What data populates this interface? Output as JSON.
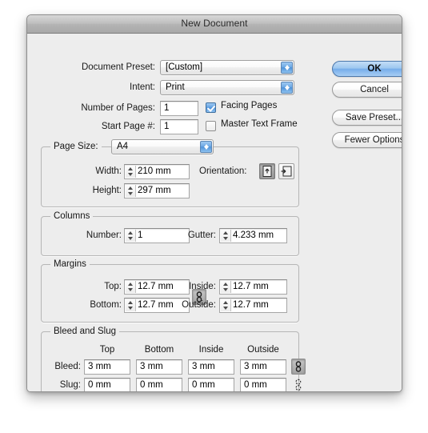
{
  "window": {
    "title": "New Document"
  },
  "fields": {
    "document_preset": {
      "label": "Document Preset:",
      "value": "[Custom]"
    },
    "intent": {
      "label": "Intent:",
      "value": "Print"
    },
    "number_of_pages": {
      "label": "Number of Pages:",
      "value": "1"
    },
    "start_page": {
      "label": "Start Page #:",
      "value": "1"
    }
  },
  "checkboxes": [
    {
      "label": "Facing Pages",
      "checked": true
    },
    {
      "label": "Master Text Frame",
      "checked": false
    }
  ],
  "buttons": {
    "ok": "OK",
    "cancel": "Cancel",
    "save_preset": "Save Preset...",
    "fewer_options": "Fewer Options"
  },
  "page_size": {
    "title": "Page Size:",
    "preset": "A4",
    "width": {
      "label": "Width:",
      "value": "210 mm"
    },
    "height": {
      "label": "Height:",
      "value": "297 mm"
    },
    "orientation": {
      "label": "Orientation:",
      "portrait_icon": "portrait-page-icon",
      "landscape_icon": "landscape-page-icon",
      "selected": "portrait"
    }
  },
  "columns": {
    "title": "Columns",
    "number": {
      "label": "Number:",
      "value": "1"
    },
    "gutter": {
      "label": "Gutter:",
      "value": "4.233 mm"
    }
  },
  "margins": {
    "title": "Margins",
    "top": {
      "label": "Top:",
      "value": "12.7 mm"
    },
    "bottom": {
      "label": "Bottom:",
      "value": "12.7 mm"
    },
    "inside": {
      "label": "Inside:",
      "value": "12.7 mm"
    },
    "outside": {
      "label": "Outside:",
      "value": "12.7 mm"
    },
    "link_icon": "chain-link-icon"
  },
  "bleed_slug": {
    "title": "Bleed and Slug",
    "columns": [
      "Top",
      "Bottom",
      "Inside",
      "Outside"
    ],
    "rows": [
      {
        "label": "Bleed:",
        "values": [
          "3 mm",
          "3 mm",
          "3 mm",
          "3 mm"
        ],
        "link_icon": "chain-link-icon"
      },
      {
        "label": "Slug:",
        "values": [
          "0 mm",
          "0 mm",
          "0 mm",
          "0 mm"
        ],
        "link_icon": "chain-broken-icon"
      }
    ]
  }
}
